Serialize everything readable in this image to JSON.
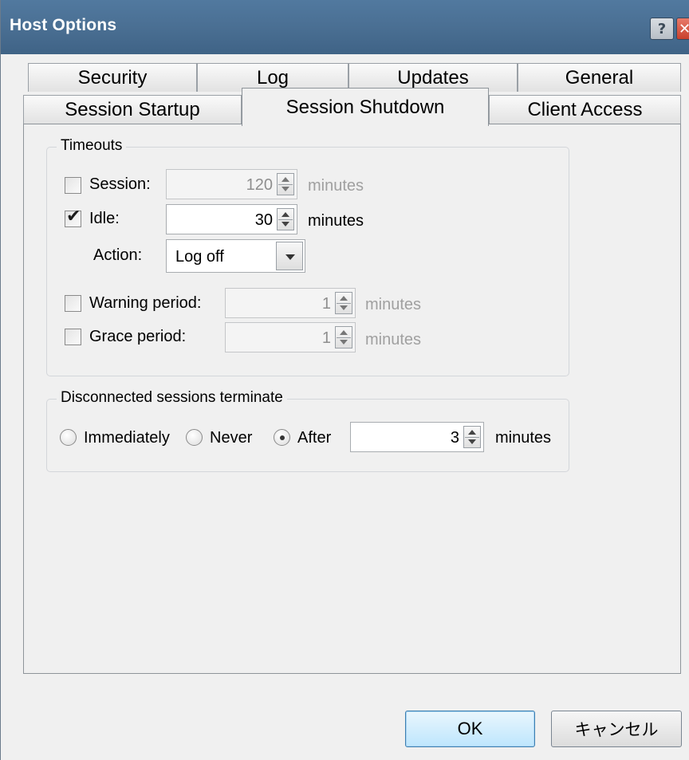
{
  "window": {
    "title": "Host Options",
    "help_glyph": "?",
    "close_glyph": "✕"
  },
  "tabs": {
    "row1": [
      "Security",
      "Log",
      "Updates",
      "General"
    ],
    "row2": [
      "Session Startup",
      "Session Shutdown",
      "Client Access"
    ],
    "active": "Session Shutdown"
  },
  "timeouts": {
    "title": "Timeouts",
    "session": {
      "label": "Session:",
      "checked": false,
      "value": "120",
      "unit": "minutes",
      "enabled": false
    },
    "idle": {
      "label": "Idle:",
      "checked": true,
      "value": "30",
      "unit": "minutes",
      "enabled": true
    },
    "action": {
      "label": "Action:",
      "value": "Log off"
    },
    "warning": {
      "label": "Warning period:",
      "checked": false,
      "value": "1",
      "unit": "minutes",
      "enabled": false
    },
    "grace": {
      "label": "Grace period:",
      "checked": false,
      "value": "1",
      "unit": "minutes",
      "enabled": false
    }
  },
  "disconnected": {
    "title": "Disconnected sessions terminate",
    "options": [
      "Immediately",
      "Never",
      "After"
    ],
    "selected": "After",
    "value": "3",
    "unit": "minutes"
  },
  "buttons": {
    "ok": "OK",
    "cancel": "キャンセル"
  },
  "colors": {
    "titlebar": "#4a6f93",
    "close": "#c8402c",
    "dialog_bg": "#f0f0f0"
  },
  "icons": {
    "check": "check-icon",
    "help": "help-icon",
    "close": "close-icon"
  }
}
